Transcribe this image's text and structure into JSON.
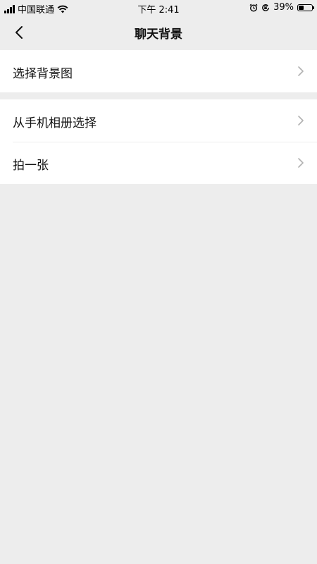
{
  "status_bar": {
    "carrier": "中国联通",
    "time": "下午 2:41",
    "battery": "39%",
    "battery_level": 0.39,
    "icons": [
      "signal-icon",
      "wifi-icon",
      "alarm-icon",
      "orientation-lock-icon",
      "battery-icon"
    ]
  },
  "nav": {
    "title": "聊天背景",
    "back_icon": "chevron-left-icon"
  },
  "groups": [
    {
      "items": [
        {
          "label": "选择背景图"
        }
      ]
    },
    {
      "items": [
        {
          "label": "从手机相册选择"
        },
        {
          "label": "拍一张"
        }
      ]
    }
  ],
  "colors": {
    "background": "#ededed",
    "row_background": "#ffffff",
    "chevron": "#b2b2b2",
    "text": "#111111"
  }
}
